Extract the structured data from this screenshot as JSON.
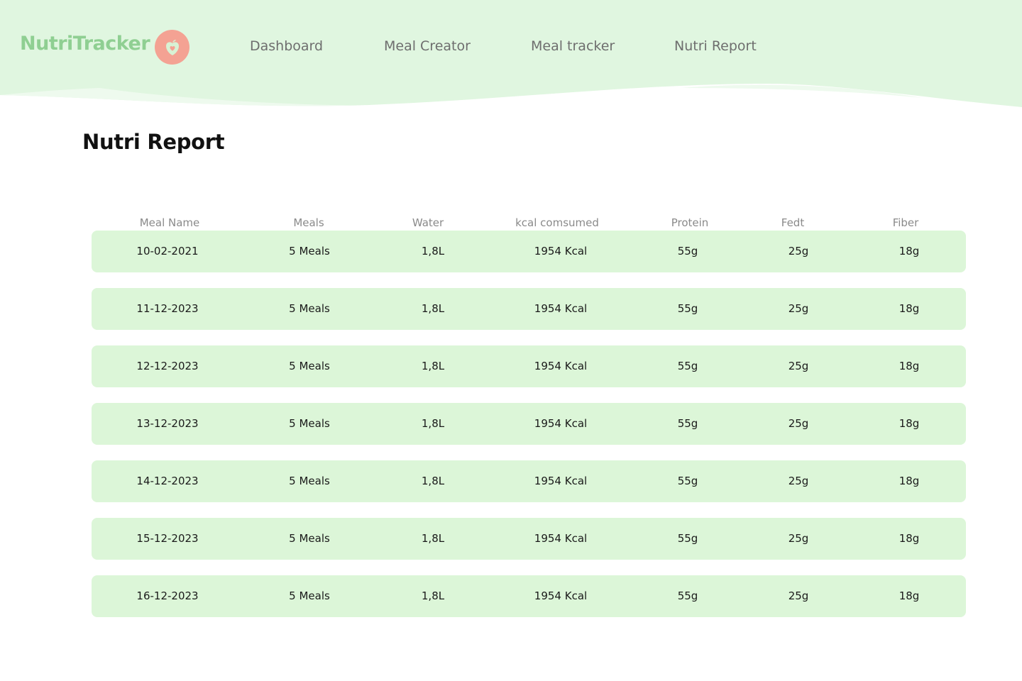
{
  "app": {
    "logo_text": "NutriTracker",
    "logo_icon": "apple-heart-icon"
  },
  "nav": {
    "items": [
      {
        "label": "Dashboard"
      },
      {
        "label": "Meal Creator"
      },
      {
        "label": "Meal tracker"
      },
      {
        "label": "Nutri Report"
      }
    ]
  },
  "page": {
    "title": "Nutri Report"
  },
  "table": {
    "columns": [
      "Meal Name",
      "Meals",
      "Water",
      "kcal comsumed",
      "Protein",
      "Fedt",
      "Fiber"
    ],
    "rows": [
      [
        "10-02-2021",
        "5 Meals",
        "1,8L",
        "1954 Kcal",
        "55g",
        "25g",
        "18g"
      ],
      [
        "11-12-2023",
        "5 Meals",
        "1,8L",
        "1954 Kcal",
        "55g",
        "25g",
        "18g"
      ],
      [
        "12-12-2023",
        "5 Meals",
        "1,8L",
        "1954 Kcal",
        "55g",
        "25g",
        "18g"
      ],
      [
        "13-12-2023",
        "5 Meals",
        "1,8L",
        "1954 Kcal",
        "55g",
        "25g",
        "18g"
      ],
      [
        "14-12-2023",
        "5 Meals",
        "1,8L",
        "1954 Kcal",
        "55g",
        "25g",
        "18g"
      ],
      [
        "15-12-2023",
        "5 Meals",
        "1,8L",
        "1954 Kcal",
        "55g",
        "25g",
        "18g"
      ],
      [
        "16-12-2023",
        "5 Meals",
        "1,8L",
        "1954 Kcal",
        "55g",
        "25g",
        "18g"
      ]
    ]
  },
  "colors": {
    "header_bg": "#e0f6e0",
    "row_bg": "#dcf6d8",
    "logo_green": "#8fcf92",
    "logo_badge": "#f4a293"
  }
}
